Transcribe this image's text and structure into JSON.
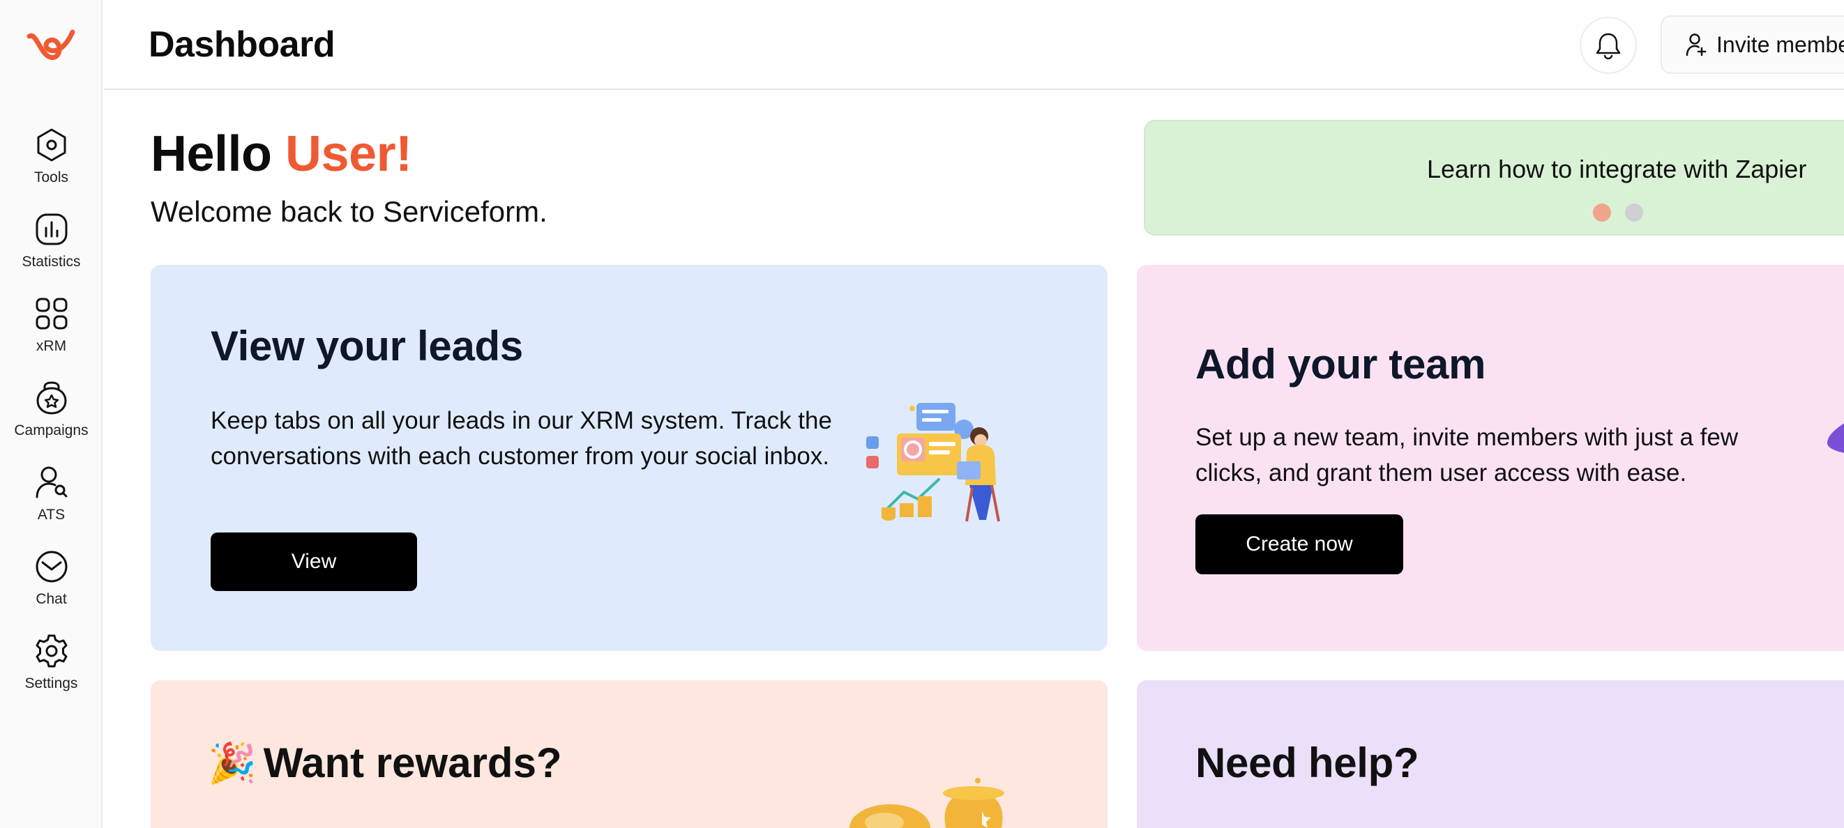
{
  "sidebar": {
    "logo_icon": "serviceform-logo-icon",
    "items": [
      {
        "label": "Tools",
        "icon": "hexagon-icon"
      },
      {
        "label": "Statistics",
        "icon": "bar-chart-icon"
      },
      {
        "label": "xRM",
        "icon": "grid-icon"
      },
      {
        "label": "Campaigns",
        "icon": "campaign-badge-icon"
      },
      {
        "label": "ATS",
        "icon": "user-search-icon"
      },
      {
        "label": "Chat",
        "icon": "chat-icon"
      },
      {
        "label": "Settings",
        "icon": "gear-icon"
      }
    ]
  },
  "header": {
    "title": "Dashboard",
    "bell_icon": "bell-icon",
    "invite_label": "Invite members"
  },
  "greeting": {
    "hello": "Hello",
    "name": "User!",
    "welcome": "Welcome back to Serviceform."
  },
  "banner": {
    "text": "Learn how to integrate with Zapier",
    "dots": [
      "active",
      "inactive"
    ]
  },
  "cards": {
    "leads": {
      "title": "View your leads",
      "description": "Keep tabs on all your leads in our XRM system. Track the conversations with each customer from your social inbox.",
      "button": "View"
    },
    "team": {
      "title": "Add your team",
      "description": "Set up a new team, invite members with just a few clicks, and grant them user access with ease.",
      "button": "Create now"
    },
    "rewards": {
      "emoji": "🎉",
      "title": "Want rewards?"
    },
    "help": {
      "title": "Need help?"
    }
  },
  "colors": {
    "accent": "#ef5a32",
    "banner_bg": "#d9f2d5",
    "leads_bg": "#dfebfc",
    "team_bg": "#fbe2f3",
    "rewards_bg": "#fde7df",
    "help_bg": "#ecdffa",
    "dot_active": "#f0a48c",
    "dot_inactive": "#cfcfd4"
  }
}
